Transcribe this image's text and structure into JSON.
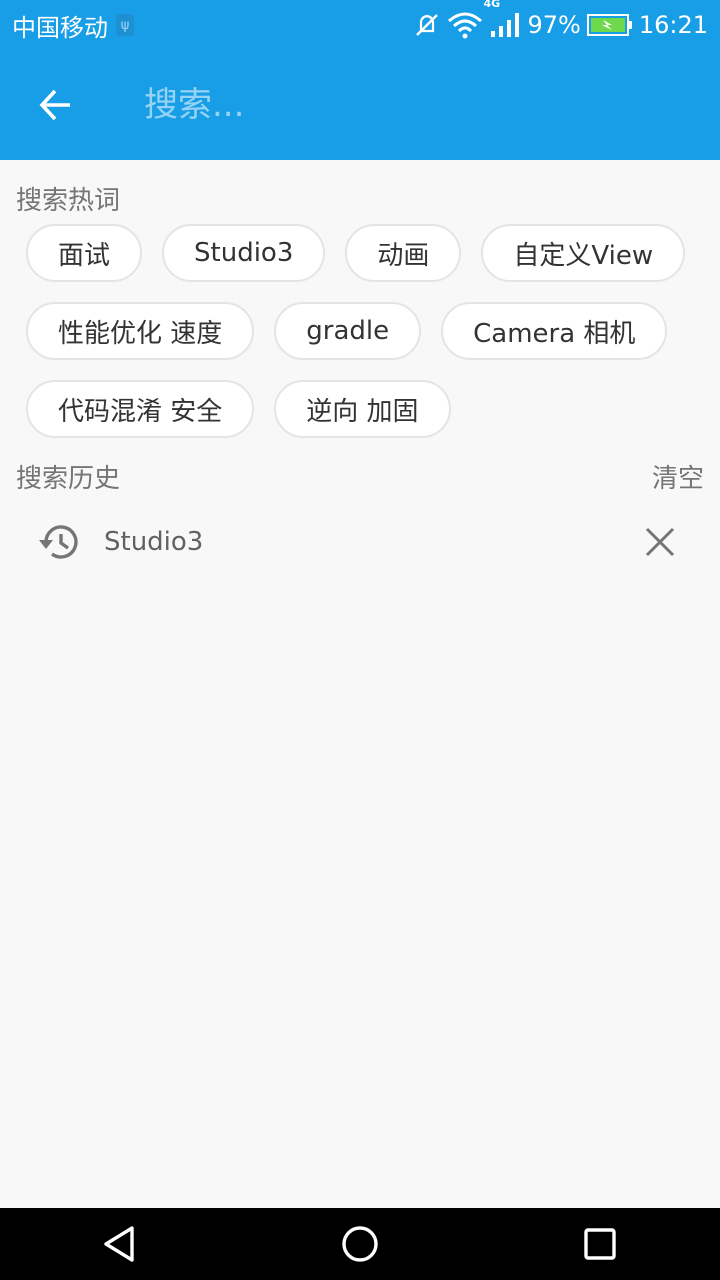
{
  "status_bar": {
    "carrier": "中国移动",
    "network": "4G",
    "battery": "97%",
    "time": "16:21"
  },
  "app_bar": {
    "search_placeholder": "搜索..."
  },
  "hot_section": {
    "title": "搜索热词",
    "tags": [
      "面试",
      "Studio3",
      "动画",
      "自定义View",
      "性能优化 速度",
      "gradle",
      "Camera 相机",
      "代码混淆 安全",
      "逆向 加固"
    ]
  },
  "history_section": {
    "title": "搜索历史",
    "clear_label": "清空",
    "items": [
      "Studio3"
    ]
  },
  "colors": {
    "primary": "#189ee6",
    "background": "#f8f8f8",
    "navbar": "#000000"
  },
  "icons": {
    "back": "arrow-left-icon",
    "history": "history-icon",
    "delete": "close-icon",
    "nav_back": "triangle-back-icon",
    "nav_home": "circle-home-icon",
    "nav_recent": "square-recent-icon"
  }
}
